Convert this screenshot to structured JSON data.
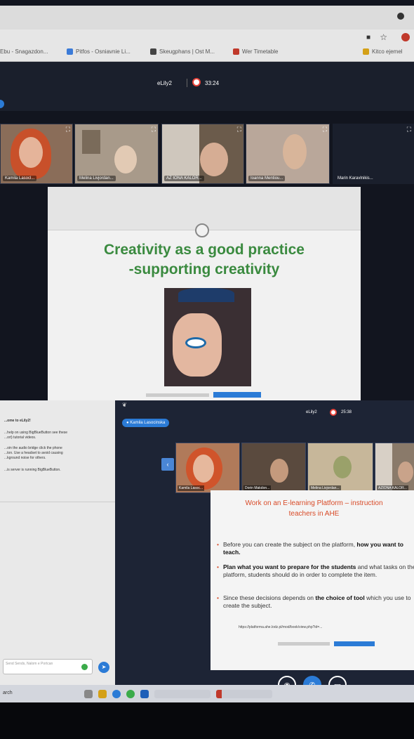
{
  "top": {
    "bookmarks": [
      {
        "label": "Ebu - Snagazdon...",
        "color": "#3b7bd8"
      },
      {
        "label": "Pitfos - Osniavnie Li...",
        "color": "#3b7bd8"
      },
      {
        "label": "Skeugphans | Ost M...",
        "color": "#444444"
      },
      {
        "label": "Wer Timetable",
        "color": "#c0392b"
      },
      {
        "label": "Kitco ejemel",
        "color": "#d4a017"
      }
    ],
    "app_name": "eLily2",
    "timer": "33:24",
    "participants": [
      {
        "name": "Kamila Lasocl...",
        "bg": "#8a6d59"
      },
      {
        "name": "Melina Livjordan...",
        "bg": "#a89a8a"
      },
      {
        "name": "AZ IONA KALOR...",
        "bg": "#7a6a5a"
      },
      {
        "name": "Ioanna Mentiou...",
        "bg": "#b9a79a"
      },
      {
        "name": "Marin Karavlnikis...",
        "bg": "#1a1f2c"
      }
    ],
    "slide": {
      "title_line1": "Creativity as a good practice",
      "title_line2": "-supporting creativity"
    }
  },
  "bottom": {
    "chat_lines": [
      "...ome to eLily2!",
      "...help on using BigBlueButton see these",
      "...ort) tutorial videos.",
      "...oin the audio bridge click the phone",
      "...ton. Use a headset to avoid causing",
      "...kground noise for others.",
      "...is server is running BigBlueButton."
    ],
    "chat_input_placeholder": "Send Sends, Nalom e Portcan",
    "search_label": "arch",
    "presenter_tag": "Kamila Lasocinska",
    "app_name": "eLily2",
    "timer": "25:38",
    "participants": [
      {
        "name": "Kamila Lasoc...",
        "bg": "#b07a5a"
      },
      {
        "name": "Dorin Makdon...",
        "bg": "#5a4a3e"
      },
      {
        "name": "Melina Livjordan...",
        "bg": "#c7b79a"
      },
      {
        "name": "AZIONA KALOR...",
        "bg": "#8a7a6a"
      }
    ],
    "slide": {
      "title_line1": "Work on an E-learning Platform – instruction",
      "title_line2": "teachers in AHE",
      "bullets": [
        {
          "plain": "Before you can create the subject on the platform, ",
          "bold": "how you want to teach."
        },
        {
          "bold": "Plan what you want to prepare for the students",
          "plain": " and what tasks on the platform, students should do in order to complete the item."
        },
        {
          "plain": "Since these decisions depends on ",
          "bold": "the choice of tool",
          "plain2": " which you use to create the subject."
        }
      ],
      "link": "https://platforma.ahe.lodz.pl/mod/book/view.php?id=",
      "link_tail": "..."
    }
  },
  "colors": {
    "accent_blue": "#2b7bd6",
    "slide_green": "#3a8a3f",
    "slide_orange": "#d84a27",
    "rec_red": "#e8433a"
  }
}
